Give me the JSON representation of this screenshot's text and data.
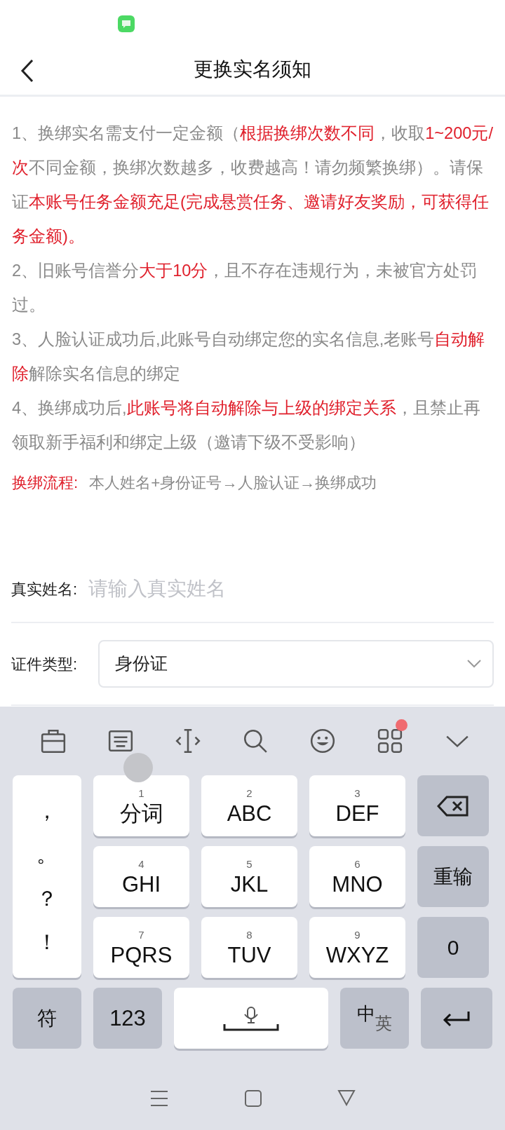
{
  "header": {
    "title": "更换实名须知"
  },
  "notices": [
    {
      "segments": [
        {
          "text": "1、换绑实名需支付一定金额（",
          "red": false
        },
        {
          "text": "根据换绑次数不同",
          "red": true
        },
        {
          "text": "，收取",
          "red": false
        },
        {
          "text": "1~200元/次",
          "red": true
        },
        {
          "text": "不同金额，换绑次数越多，收费越高！请勿频繁换绑）。请保证",
          "red": false
        },
        {
          "text": "本账号任务金额充足(完成悬赏任务、邀请好友奖励，可获得任务金额)。",
          "red": true
        }
      ]
    },
    {
      "segments": [
        {
          "text": "2、旧账号信誉分",
          "red": false
        },
        {
          "text": "大于10分",
          "red": true
        },
        {
          "text": "，且不存在违规行为，未被官方处罚过。",
          "red": false
        }
      ]
    },
    {
      "segments": [
        {
          "text": "3、人脸认证成功后,此账号自动绑定您的实名信息,老账号",
          "red": false
        },
        {
          "text": "自动解除",
          "red": true
        },
        {
          "text": "解除实名信息的绑定",
          "red": false
        }
      ]
    },
    {
      "segments": [
        {
          "text": "4、换绑成功后,",
          "red": false
        },
        {
          "text": "此账号将自动解除与上级的绑定关系",
          "red": true
        },
        {
          "text": "，且禁止再领取新手福利和绑定上级（邀请下级不受影响）",
          "red": false
        }
      ]
    }
  ],
  "process": {
    "label": "换绑流程:",
    "text": "本人姓名+身份证号→人脸认证→换绑成功"
  },
  "form": {
    "name_field": {
      "label": "真实姓名:",
      "placeholder": "请输入真实姓名"
    },
    "id_type": {
      "label": "证件类型:",
      "value": "身份证"
    }
  },
  "keyboard": {
    "apps_badge": true,
    "punctuation": [
      "，",
      "。",
      "？",
      "！"
    ],
    "keys": [
      {
        "digit": "1",
        "label": "分词"
      },
      {
        "digit": "2",
        "label": "ABC"
      },
      {
        "digit": "3",
        "label": "DEF"
      },
      {
        "digit": "4",
        "label": "GHI"
      },
      {
        "digit": "5",
        "label": "JKL"
      },
      {
        "digit": "6",
        "label": "MNO"
      },
      {
        "digit": "7",
        "label": "PQRS"
      },
      {
        "digit": "8",
        "label": "TUV"
      },
      {
        "digit": "9",
        "label": "WXYZ"
      }
    ],
    "reset_key": "重输",
    "zero_key": "0",
    "symbol_key": "符",
    "number_key": "123",
    "lang_key": {
      "primary": "中",
      "secondary": "英"
    }
  }
}
